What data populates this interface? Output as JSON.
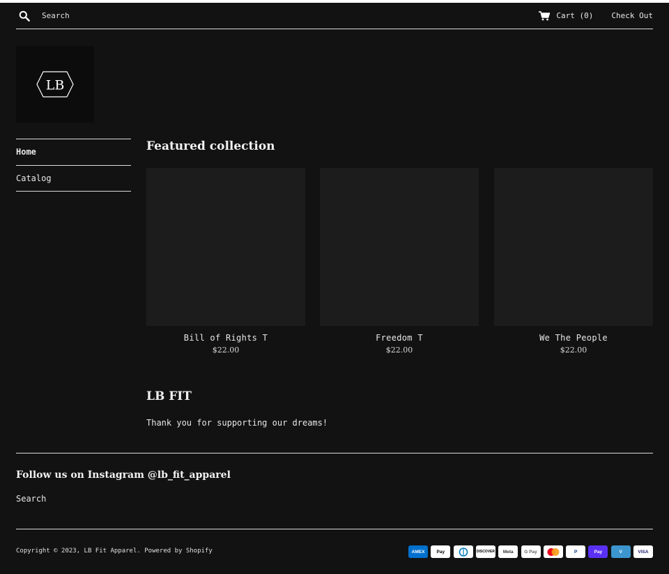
{
  "header": {
    "search_label": "Search",
    "cart_label": "Cart (0)",
    "checkout_label": "Check Out"
  },
  "logo": {
    "text": "LB"
  },
  "nav": {
    "items": [
      {
        "label": "Home"
      },
      {
        "label": "Catalog"
      }
    ]
  },
  "featured": {
    "title": "Featured collection",
    "products": [
      {
        "title": "Bill of Rights T",
        "price": "$22.00"
      },
      {
        "title": "Freedom T",
        "price": "$22.00"
      },
      {
        "title": "We The People",
        "price": "$22.00"
      }
    ]
  },
  "about": {
    "title": "LB FIT",
    "text": "Thank you for supporting our dreams!"
  },
  "footer": {
    "heading": "Follow us on Instagram @lb_fit_apparel",
    "search_link": "Search",
    "copyright": "Copyright © 2023, LB Fit Apparel. Powered by Shopify",
    "payment_methods": [
      {
        "name": "amex-icon",
        "label": "AMEX",
        "bg": "#0070cd",
        "fg": "#ffffff"
      },
      {
        "name": "apple-pay-icon",
        "label": "Pay",
        "bg": "#ffffff",
        "fg": "#000000"
      },
      {
        "name": "diners-club-icon",
        "label": "",
        "bg": "#ffffff",
        "fg": "#0079be"
      },
      {
        "name": "discover-icon",
        "label": "DISCOVER",
        "bg": "#ffffff",
        "fg": "#000000"
      },
      {
        "name": "meta-pay-icon",
        "label": "Meta",
        "bg": "#ffffff",
        "fg": "#333333"
      },
      {
        "name": "google-pay-icon",
        "label": "G Pay",
        "bg": "#ffffff",
        "fg": "#5f6368"
      },
      {
        "name": "mastercard-icon",
        "label": "",
        "bg": "#ffffff",
        "fg": "#000000"
      },
      {
        "name": "paypal-icon",
        "label": "P",
        "bg": "#ffffff",
        "fg": "#003087"
      },
      {
        "name": "shop-pay-icon",
        "label": "Pay",
        "bg": "#5a31f4",
        "fg": "#ffffff"
      },
      {
        "name": "venmo-icon",
        "label": "V",
        "bg": "#3d95ce",
        "fg": "#ffffff"
      },
      {
        "name": "visa-icon",
        "label": "VISA",
        "bg": "#ffffff",
        "fg": "#1a1f71"
      }
    ]
  },
  "colors": {
    "background": "#121212",
    "product_placeholder": "#1c1c1c",
    "text": "#e8e8e8",
    "rule": "#dcdcdc"
  }
}
